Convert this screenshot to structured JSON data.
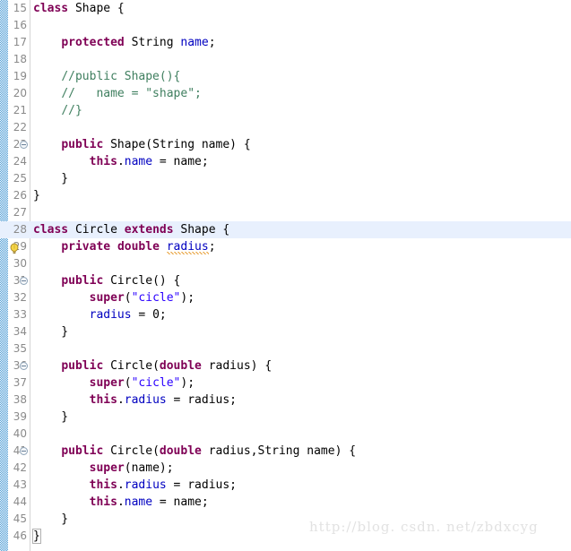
{
  "editor": {
    "language": "java",
    "first_line_number": 15,
    "current_line_number": 28,
    "colors": {
      "keyword": "#7f0055",
      "string": "#2a00ff",
      "comment": "#3f7f5f",
      "field": "#0000c0",
      "plain": "#000000",
      "background": "#ffffff",
      "current_line_highlight": "#e8f0fd",
      "line_number": "#8a8a8a",
      "change_ruler": "#4a9ad4",
      "warning_squiggle": "#e8a33d",
      "watermark": "#e2e2e2"
    },
    "lines": [
      {
        "number": "15",
        "fold": false,
        "marker": "",
        "current": false,
        "tokens": [
          {
            "t": "class",
            "c": "kw"
          },
          {
            "t": " Shape {",
            "c": "plain"
          }
        ]
      },
      {
        "number": "16",
        "fold": false,
        "marker": "",
        "current": false,
        "tokens": []
      },
      {
        "number": "17",
        "fold": false,
        "marker": "",
        "current": false,
        "tokens": [
          {
            "t": "    ",
            "c": "plain"
          },
          {
            "t": "protected",
            "c": "kw"
          },
          {
            "t": " String ",
            "c": "plain"
          },
          {
            "t": "name",
            "c": "fld"
          },
          {
            "t": ";",
            "c": "plain"
          }
        ]
      },
      {
        "number": "18",
        "fold": false,
        "marker": "",
        "current": false,
        "tokens": []
      },
      {
        "number": "19",
        "fold": false,
        "marker": "",
        "current": false,
        "tokens": [
          {
            "t": "    ",
            "c": "plain"
          },
          {
            "t": "//public Shape(){",
            "c": "cmt"
          }
        ]
      },
      {
        "number": "20",
        "fold": false,
        "marker": "",
        "current": false,
        "tokens": [
          {
            "t": "    ",
            "c": "plain"
          },
          {
            "t": "//   name = \"shape\";",
            "c": "cmt"
          }
        ]
      },
      {
        "number": "21",
        "fold": false,
        "marker": "",
        "current": false,
        "tokens": [
          {
            "t": "    ",
            "c": "plain"
          },
          {
            "t": "//}",
            "c": "cmt"
          }
        ]
      },
      {
        "number": "22",
        "fold": false,
        "marker": "",
        "current": false,
        "tokens": []
      },
      {
        "number": "23",
        "fold": true,
        "marker": "",
        "current": false,
        "tokens": [
          {
            "t": "    ",
            "c": "plain"
          },
          {
            "t": "public",
            "c": "kw"
          },
          {
            "t": " Shape(String name) {",
            "c": "plain"
          }
        ]
      },
      {
        "number": "24",
        "fold": false,
        "marker": "",
        "current": false,
        "tokens": [
          {
            "t": "        ",
            "c": "plain"
          },
          {
            "t": "this",
            "c": "kw"
          },
          {
            "t": ".",
            "c": "plain"
          },
          {
            "t": "name",
            "c": "fld"
          },
          {
            "t": " = name;",
            "c": "plain"
          }
        ]
      },
      {
        "number": "25",
        "fold": false,
        "marker": "",
        "current": false,
        "tokens": [
          {
            "t": "    }",
            "c": "plain"
          }
        ]
      },
      {
        "number": "26",
        "fold": false,
        "marker": "",
        "current": false,
        "tokens": [
          {
            "t": "}",
            "c": "plain"
          }
        ]
      },
      {
        "number": "27",
        "fold": false,
        "marker": "",
        "current": false,
        "tokens": []
      },
      {
        "number": "28",
        "fold": false,
        "marker": "",
        "current": true,
        "tokens": [
          {
            "t": "class",
            "c": "kw"
          },
          {
            "t": " Circle ",
            "c": "plain"
          },
          {
            "t": "extends",
            "c": "kw"
          },
          {
            "t": " Shape {",
            "c": "plain"
          }
        ]
      },
      {
        "number": "29",
        "fold": false,
        "marker": "warning-bulb-icon",
        "current": false,
        "tokens": [
          {
            "t": "    ",
            "c": "plain"
          },
          {
            "t": "private",
            "c": "kw"
          },
          {
            "t": " ",
            "c": "plain"
          },
          {
            "t": "double",
            "c": "kw"
          },
          {
            "t": " ",
            "c": "plain"
          },
          {
            "t": "radius",
            "c": "fld warnline"
          },
          {
            "t": ";",
            "c": "plain"
          }
        ]
      },
      {
        "number": "30",
        "fold": false,
        "marker": "",
        "current": false,
        "tokens": []
      },
      {
        "number": "31",
        "fold": true,
        "marker": "",
        "current": false,
        "tokens": [
          {
            "t": "    ",
            "c": "plain"
          },
          {
            "t": "public",
            "c": "kw"
          },
          {
            "t": " Circle() {",
            "c": "plain"
          }
        ]
      },
      {
        "number": "32",
        "fold": false,
        "marker": "",
        "current": false,
        "tokens": [
          {
            "t": "        ",
            "c": "plain"
          },
          {
            "t": "super",
            "c": "kw"
          },
          {
            "t": "(",
            "c": "plain"
          },
          {
            "t": "\"cicle\"",
            "c": "str"
          },
          {
            "t": ");",
            "c": "plain"
          }
        ]
      },
      {
        "number": "33",
        "fold": false,
        "marker": "",
        "current": false,
        "tokens": [
          {
            "t": "        ",
            "c": "plain"
          },
          {
            "t": "radius",
            "c": "fld"
          },
          {
            "t": " = 0;",
            "c": "plain"
          }
        ]
      },
      {
        "number": "34",
        "fold": false,
        "marker": "",
        "current": false,
        "tokens": [
          {
            "t": "    }",
            "c": "plain"
          }
        ]
      },
      {
        "number": "35",
        "fold": false,
        "marker": "",
        "current": false,
        "tokens": []
      },
      {
        "number": "36",
        "fold": true,
        "marker": "",
        "current": false,
        "tokens": [
          {
            "t": "    ",
            "c": "plain"
          },
          {
            "t": "public",
            "c": "kw"
          },
          {
            "t": " Circle(",
            "c": "plain"
          },
          {
            "t": "double",
            "c": "kw"
          },
          {
            "t": " radius) {",
            "c": "plain"
          }
        ]
      },
      {
        "number": "37",
        "fold": false,
        "marker": "",
        "current": false,
        "tokens": [
          {
            "t": "        ",
            "c": "plain"
          },
          {
            "t": "super",
            "c": "kw"
          },
          {
            "t": "(",
            "c": "plain"
          },
          {
            "t": "\"cicle\"",
            "c": "str"
          },
          {
            "t": ");",
            "c": "plain"
          }
        ]
      },
      {
        "number": "38",
        "fold": false,
        "marker": "",
        "current": false,
        "tokens": [
          {
            "t": "        ",
            "c": "plain"
          },
          {
            "t": "this",
            "c": "kw"
          },
          {
            "t": ".",
            "c": "plain"
          },
          {
            "t": "radius",
            "c": "fld"
          },
          {
            "t": " = radius;",
            "c": "plain"
          }
        ]
      },
      {
        "number": "39",
        "fold": false,
        "marker": "",
        "current": false,
        "tokens": [
          {
            "t": "    }",
            "c": "plain"
          }
        ]
      },
      {
        "number": "40",
        "fold": false,
        "marker": "",
        "current": false,
        "tokens": []
      },
      {
        "number": "41",
        "fold": true,
        "marker": "",
        "current": false,
        "tokens": [
          {
            "t": "    ",
            "c": "plain"
          },
          {
            "t": "public",
            "c": "kw"
          },
          {
            "t": " Circle(",
            "c": "plain"
          },
          {
            "t": "double",
            "c": "kw"
          },
          {
            "t": " radius,String name) {",
            "c": "plain"
          }
        ]
      },
      {
        "number": "42",
        "fold": false,
        "marker": "",
        "current": false,
        "tokens": [
          {
            "t": "        ",
            "c": "plain"
          },
          {
            "t": "super",
            "c": "kw"
          },
          {
            "t": "(name);",
            "c": "plain"
          }
        ]
      },
      {
        "number": "43",
        "fold": false,
        "marker": "",
        "current": false,
        "tokens": [
          {
            "t": "        ",
            "c": "plain"
          },
          {
            "t": "this",
            "c": "kw"
          },
          {
            "t": ".",
            "c": "plain"
          },
          {
            "t": "radius",
            "c": "fld"
          },
          {
            "t": " = radius;",
            "c": "plain"
          }
        ]
      },
      {
        "number": "44",
        "fold": false,
        "marker": "",
        "current": false,
        "tokens": [
          {
            "t": "        ",
            "c": "plain"
          },
          {
            "t": "this",
            "c": "kw"
          },
          {
            "t": ".",
            "c": "plain"
          },
          {
            "t": "name",
            "c": "fld"
          },
          {
            "t": " = name;",
            "c": "plain"
          }
        ]
      },
      {
        "number": "45",
        "fold": false,
        "marker": "",
        "current": false,
        "tokens": [
          {
            "t": "    }",
            "c": "plain"
          }
        ]
      },
      {
        "number": "46",
        "fold": false,
        "marker": "",
        "current": false,
        "bracket_match": true,
        "tokens": [
          {
            "t": "}",
            "c": "plain"
          }
        ]
      }
    ]
  },
  "watermark": {
    "text": "http://blog. csdn. net/zbdxcyg"
  }
}
